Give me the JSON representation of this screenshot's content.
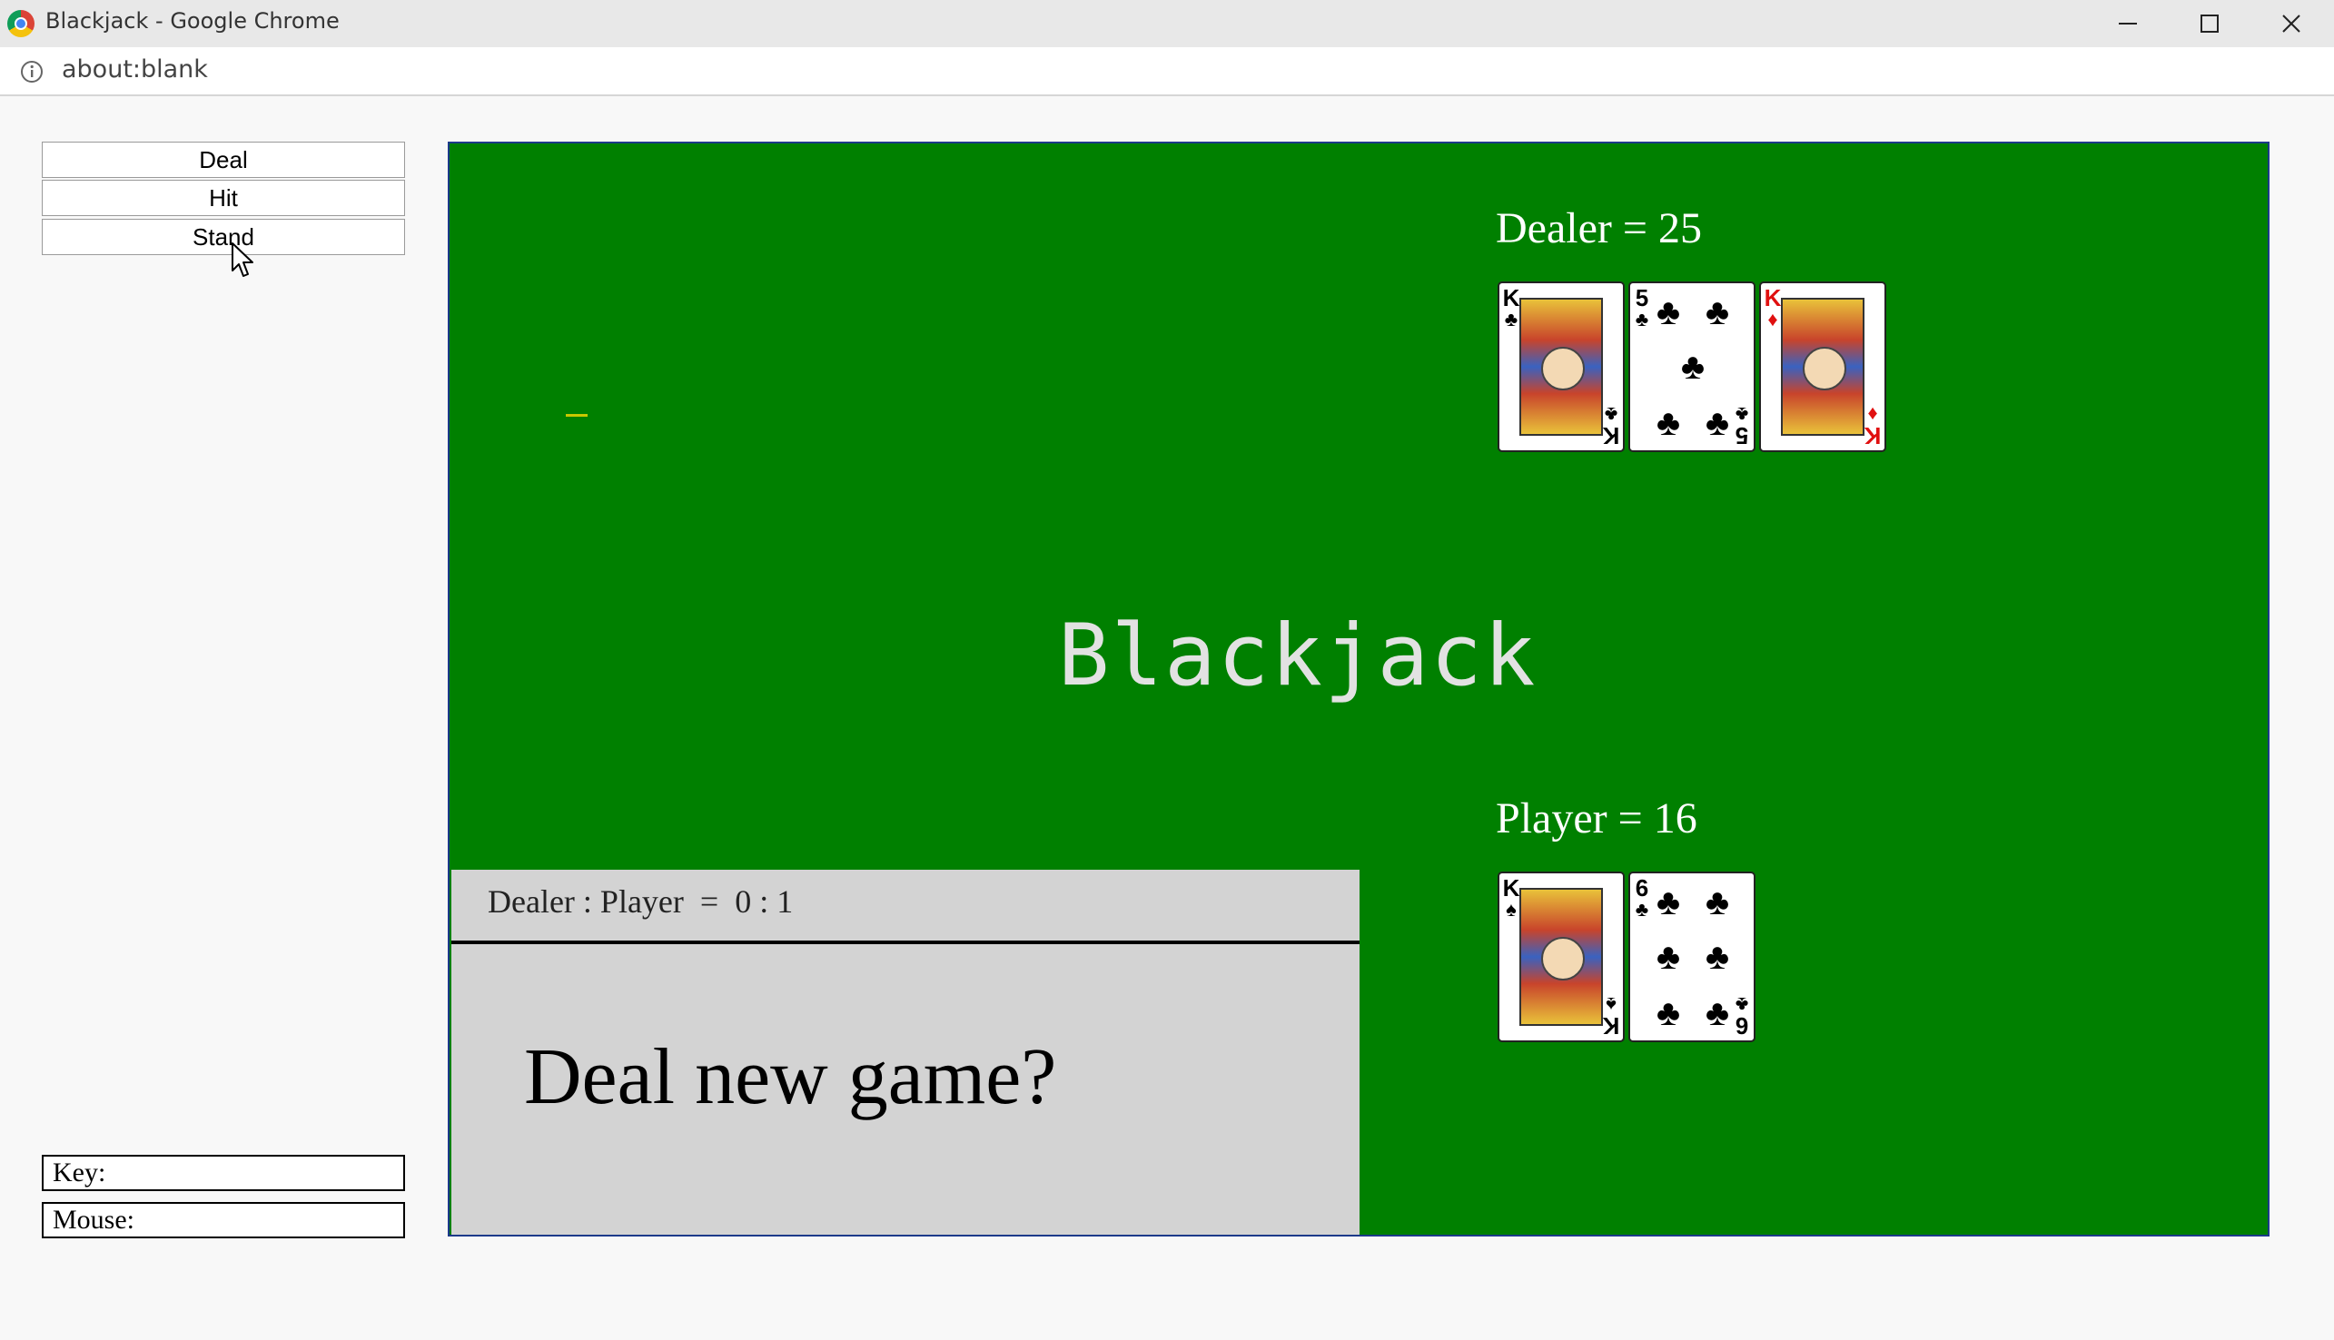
{
  "window": {
    "title": "Blackjack - Google Chrome",
    "url": "about:blank"
  },
  "controls": {
    "deal_label": "Deal",
    "hit_label": "Hit",
    "stand_label": "Stand"
  },
  "status": {
    "key_label": "Key:",
    "mouse_label": "Mouse:"
  },
  "game": {
    "title": "Blackjack",
    "table_color": "#008000",
    "dealer": {
      "label": "Dealer = 25",
      "cards": [
        {
          "rank": "K",
          "suit": "♣",
          "color": "black",
          "type": "face"
        },
        {
          "rank": "5",
          "suit": "♣",
          "color": "black",
          "type": "pips"
        },
        {
          "rank": "K",
          "suit": "♦",
          "color": "red",
          "type": "face"
        }
      ]
    },
    "player": {
      "label": "Player = 16",
      "cards": [
        {
          "rank": "K",
          "suit": "♠",
          "color": "black",
          "type": "face"
        },
        {
          "rank": "6",
          "suit": "♣",
          "color": "black",
          "type": "pips"
        }
      ]
    },
    "tally": "Dealer : Player  =  0 : 1",
    "prompt": "Deal new game?"
  }
}
